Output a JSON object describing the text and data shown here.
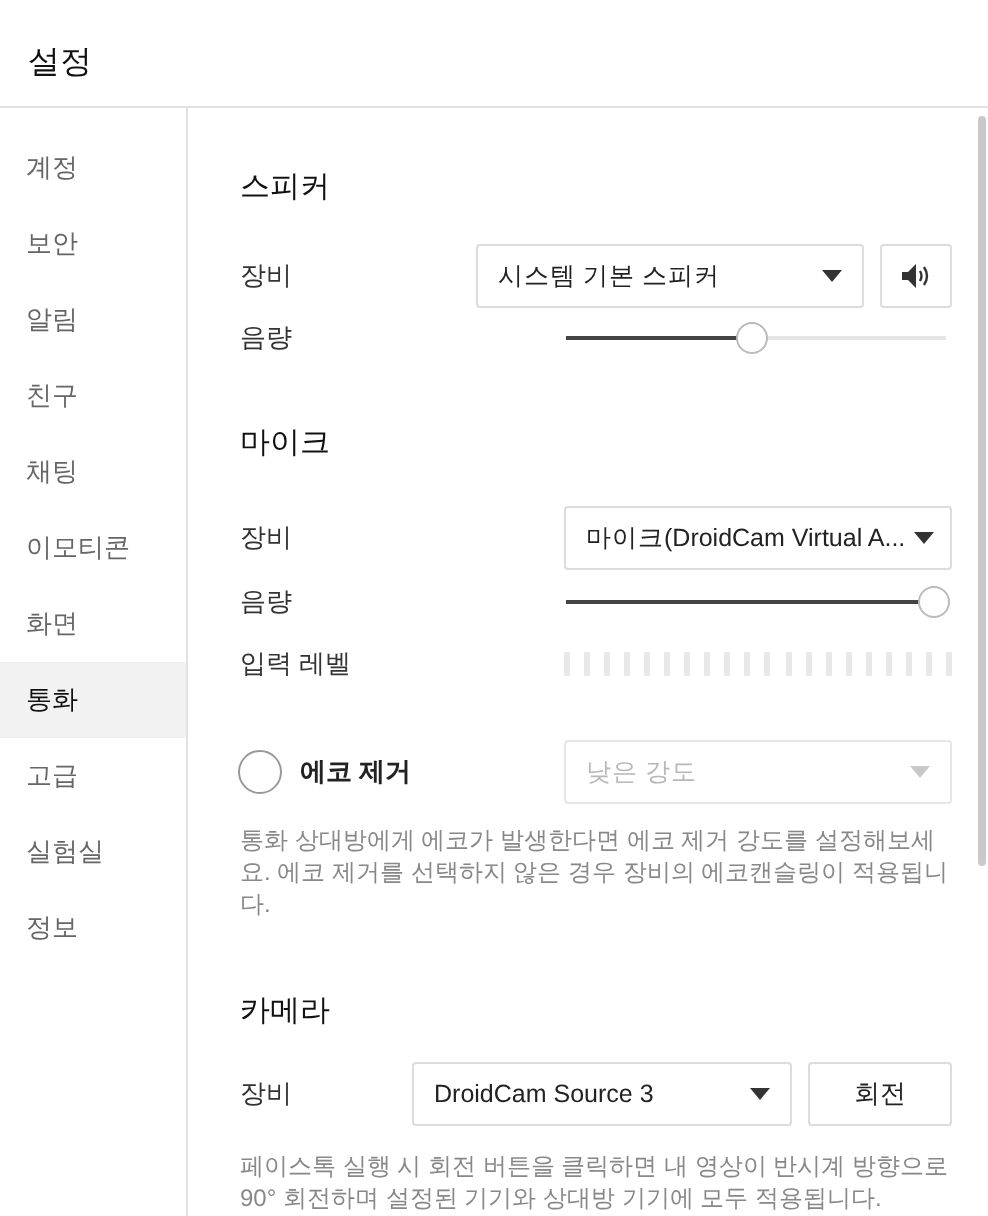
{
  "title": "설정",
  "sidebar": {
    "items": [
      {
        "label": "계정",
        "selected": false
      },
      {
        "label": "보안",
        "selected": false
      },
      {
        "label": "알림",
        "selected": false
      },
      {
        "label": "친구",
        "selected": false
      },
      {
        "label": "채팅",
        "selected": false
      },
      {
        "label": "이모티콘",
        "selected": false
      },
      {
        "label": "화면",
        "selected": false
      },
      {
        "label": "통화",
        "selected": true
      },
      {
        "label": "고급",
        "selected": false
      },
      {
        "label": "실험실",
        "selected": false
      },
      {
        "label": "정보",
        "selected": false
      }
    ]
  },
  "speaker": {
    "heading": "스피커",
    "device_label": "장비",
    "device": "시스템 기본 스피커",
    "volume_label": "음량",
    "volume": {
      "level": 0.49
    }
  },
  "mic": {
    "heading": "마이크",
    "device_label": "장비",
    "device": "마이크(DroidCam Virtual A...",
    "volume_label": "음량",
    "volume": {
      "level": 0.97
    },
    "input_label": "입력 레벨",
    "echo": {
      "label": "에코 제거",
      "checked": false,
      "strength": {
        "value": "낮은 강도",
        "disabled": true
      }
    },
    "note": "통화 상대방에게 에코가 발생한다면 에코 제거 강도를 설정해보세요. 에코 제거를 선택하지 않은 경우 장비의 에코캔슬링이 적용됩니다."
  },
  "camera": {
    "heading": "카메라",
    "device_label": "장비",
    "device": "DroidCam Source 3",
    "rotate_button": "회전",
    "note": "페이스톡 실행 시 회전 버튼을 클릭하면 내 영상이 반시계 방향으로 90° 회전하며 설정된 기기와 상대방 기기에 모두 적용됩니다."
  }
}
